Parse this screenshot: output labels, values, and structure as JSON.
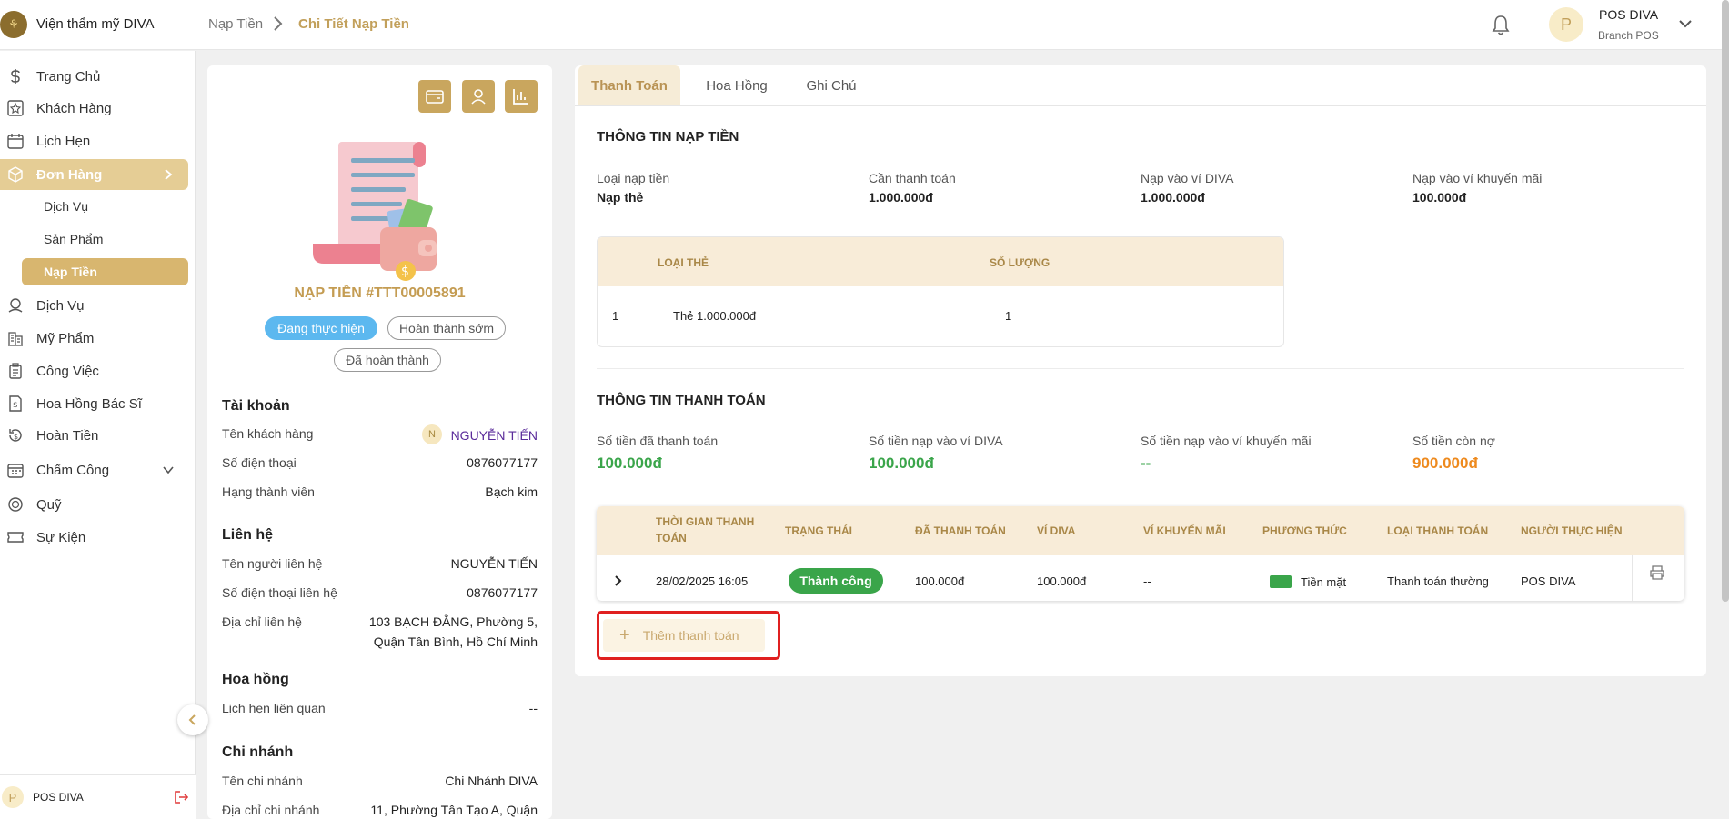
{
  "header": {
    "brand": "Viện thẩm mỹ DIVA",
    "breadcrumb": [
      "Nạp Tiền",
      "Chi Tiết Nạp Tiền"
    ],
    "user": {
      "name": "POS DIVA",
      "role": "Branch POS",
      "avatar_letter": "P"
    }
  },
  "sidebar": {
    "items": [
      {
        "label": "Trang Chủ",
        "icon": "dollar-icon"
      },
      {
        "label": "Khách Hàng",
        "icon": "star-icon"
      },
      {
        "label": "Lịch Hẹn",
        "icon": "calendar-icon"
      },
      {
        "label": "Đơn Hàng",
        "icon": "box-icon",
        "active": true
      },
      {
        "label": "Dịch Vụ",
        "icon": "map-pin-icon"
      },
      {
        "label": "Mỹ Phẩm",
        "icon": "building-icon"
      },
      {
        "label": "Công Việc",
        "icon": "clipboard-icon"
      },
      {
        "label": "Hoa Hồng Bác Sĩ",
        "icon": "document-dollar-icon"
      },
      {
        "label": "Hoàn Tiền",
        "icon": "refund-icon"
      },
      {
        "label": "Chấm Công",
        "icon": "calendar-grid-icon"
      },
      {
        "label": "Quỹ",
        "icon": "coin-icon"
      },
      {
        "label": "Sự Kiện",
        "icon": "ticket-icon"
      }
    ],
    "sub_items": [
      {
        "label": "Dịch Vụ"
      },
      {
        "label": "Sản Phẩm"
      },
      {
        "label": "Nạp Tiền",
        "active": true
      }
    ],
    "footer_user": "POS DIVA",
    "footer_avatar": "P"
  },
  "order": {
    "title": "NẠP TIỀN #TTT00005891",
    "statuses": [
      "Đang thực hiện",
      "Hoàn thành sớm",
      "Đã hoàn thành"
    ],
    "account": {
      "title": "Tài khoản",
      "rows": [
        {
          "label": "Tên khách hàng",
          "value": "NGUYỄN TIẾN",
          "avatar": "N"
        },
        {
          "label": "Số điện thoại",
          "value": "0876077177"
        },
        {
          "label": "Hạng thành viên",
          "value": "Bạch kim"
        }
      ]
    },
    "contact": {
      "title": "Liên hệ",
      "rows": [
        {
          "label": "Tên người liên hệ",
          "value": "NGUYỄN TIẾN"
        },
        {
          "label": "Số điện thoại liên hệ",
          "value": "0876077177"
        },
        {
          "label": "Địa chỉ liên hệ",
          "value": "103 BẠCH ĐẰNG, Phường 5,",
          "value2": "Quận Tân Bình, Hồ Chí Minh"
        }
      ]
    },
    "commission": {
      "title": "Hoa hồng",
      "rows": [
        {
          "label": "Lịch hẹn liên quan",
          "value": "--"
        }
      ]
    },
    "branch": {
      "title": "Chi nhánh",
      "rows": [
        {
          "label": "Tên chi nhánh",
          "value": "Chi Nhánh DIVA"
        },
        {
          "label": "Địa chỉ chi nhánh",
          "value": "11, Phường Tân Tạo A, Quận"
        }
      ]
    }
  },
  "tabs": [
    "Thanh Toán",
    "Hoa Hồng",
    "Ghi Chú"
  ],
  "topup_info": {
    "title": "THÔNG TIN NẠP TIỀN",
    "fields": [
      {
        "label": "Loại nạp tiền",
        "value": "Nạp thẻ"
      },
      {
        "label": "Cần thanh toán",
        "value": "1.000.000đ"
      },
      {
        "label": "Nạp vào ví DIVA",
        "value": "1.000.000đ"
      },
      {
        "label": "Nạp vào ví khuyến mãi",
        "value": "100.000đ"
      }
    ],
    "card_table": {
      "headers": [
        "LOẠI THẺ",
        "SỐ LƯỢNG"
      ],
      "rows": [
        {
          "index": "1",
          "card": "Thẻ 1.000.000đ",
          "qty": "1"
        }
      ]
    }
  },
  "payment_info": {
    "title": "THÔNG TIN THANH TOÁN",
    "fields": [
      {
        "label": "Số tiền đã thanh toán",
        "value": "100.000đ"
      },
      {
        "label": "Số tiền nạp vào ví DIVA",
        "value": "100.000đ"
      },
      {
        "label": "Số tiền nạp vào ví khuyến mãi",
        "value": "--"
      },
      {
        "label": "Số tiền còn nợ",
        "value": "900.000đ"
      }
    ],
    "table": {
      "headers": [
        "THỜI GIAN THANH",
        "TOÁN",
        "TRẠNG THÁI",
        "ĐÃ THANH TOÁN",
        "VÍ DIVA",
        "VÍ KHUYẾN MÃI",
        "PHƯƠNG THỨC",
        "LOẠI THANH TOÁN",
        "NGƯỜI THỰC HIỆN"
      ],
      "rows": [
        {
          "time": "28/02/2025 16:05",
          "status": "Thành công",
          "paid": "100.000đ",
          "diva": "100.000đ",
          "promo": "--",
          "method": "Tiền mặt",
          "type": "Thanh toán thường",
          "by": "POS DIVA"
        }
      ]
    },
    "add_button": "Thêm thanh toán"
  },
  "colors": {
    "accent": "#c9a65e",
    "active_nav": "#e5cd95",
    "success": "#3aa54a",
    "debt": "#ee8a1e",
    "status_on": "#5cb8ef"
  }
}
